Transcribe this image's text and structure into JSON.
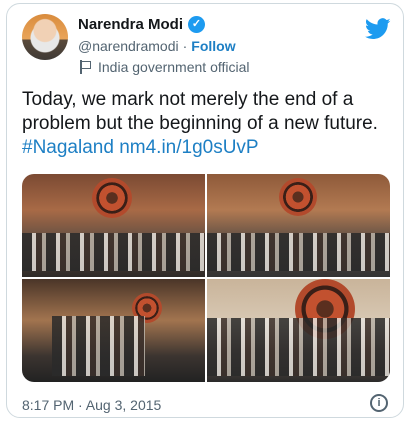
{
  "author": {
    "name": "Narendra Modi",
    "handle": "@narendramodi",
    "separator": "·",
    "follow_label": "Follow",
    "account_label": "India government official"
  },
  "tweet": {
    "text": "Today, we mark not merely the end of a problem but the beginning of a new future.",
    "hashtag": "#Nagaland",
    "link": "nm4.in/1g0sUvP"
  },
  "timestamp": "8:17 PM · Aug 3, 2015",
  "icons": {
    "verified": "verified-badge-icon",
    "flag": "government-flag-icon",
    "brand": "twitter-bird-icon",
    "info": "info-icon"
  },
  "colors": {
    "link": "#1d7fc4",
    "brand": "#1d9bf0",
    "secondary_text": "#536471"
  }
}
